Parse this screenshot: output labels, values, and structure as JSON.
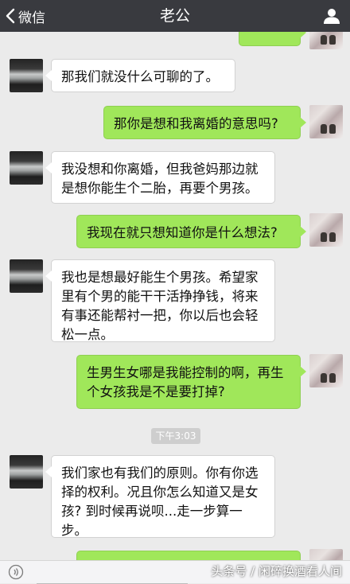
{
  "header": {
    "back_label": "微信",
    "title": "老公"
  },
  "messages": [
    {
      "from": "in",
      "text": "那我们就没什么可聊的了。"
    },
    {
      "from": "out",
      "text": "那你是想和我离婚的意思吗?"
    },
    {
      "from": "in",
      "text": "我没想和你离婚，但我爸妈那边就是想你能生个二胎，再要个男孩。"
    },
    {
      "from": "out",
      "text": "我现在就只想知道你是什么想法?"
    },
    {
      "from": "in",
      "text": "我也是想最好能生个男孩。希望家里有个男的能干干活挣挣钱，将来有事还能帮衬一把，你以后也会轻松一点。"
    },
    {
      "from": "out",
      "text": "生男生女哪是我能控制的啊，再生个女孩我是不是要打掉?"
    },
    {
      "from": "in",
      "text": "我们家也有我们的原则。你有你选择的权利。况且你怎么知道又是女孩? 到时候再说呗...走一步算一步。"
    }
  ],
  "timestamp": "下午3:03",
  "watermark": "头条号 / 闲碎换酒看人间",
  "colors": {
    "topbar": "#393a3f",
    "background": "#ebebeb",
    "outgoing_bubble": "#a0e75a",
    "incoming_bubble": "#ffffff"
  }
}
